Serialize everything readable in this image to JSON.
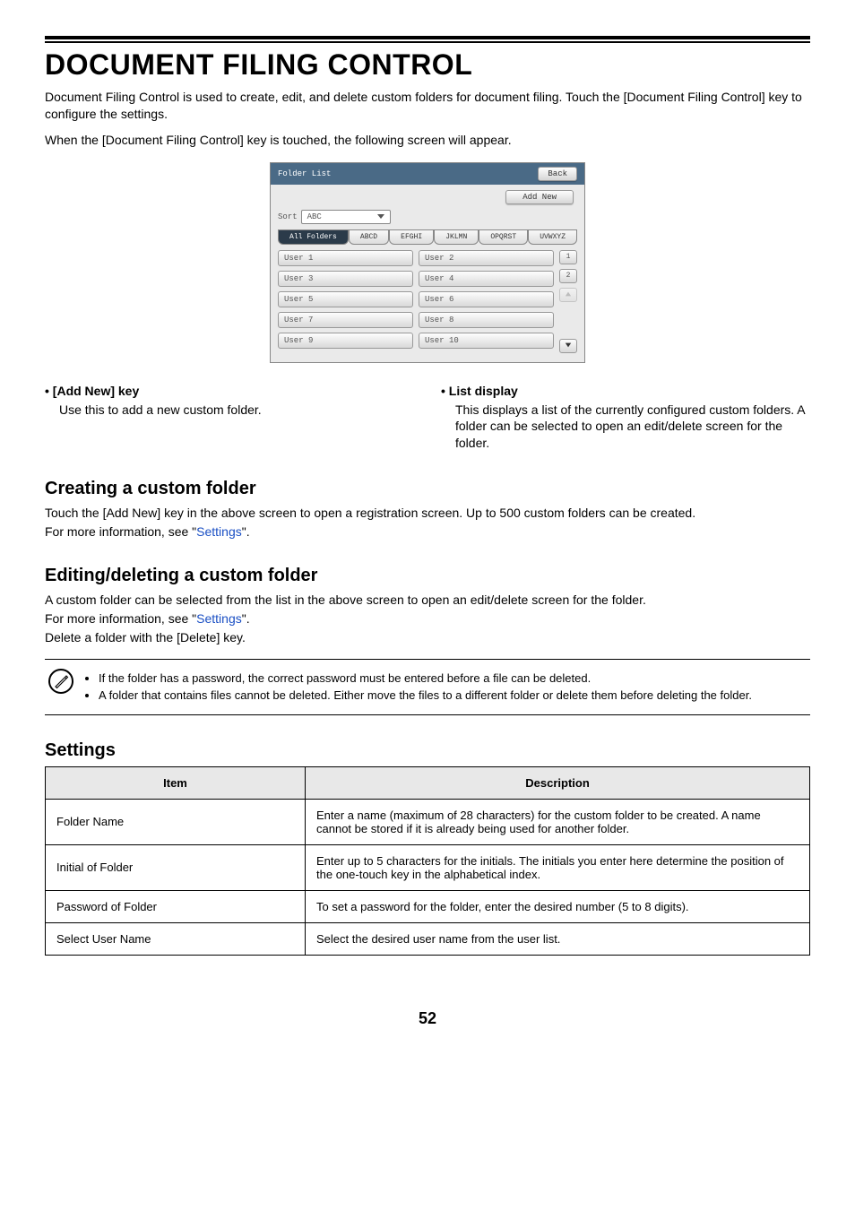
{
  "headings": {
    "main": "DOCUMENT FILING CONTROL",
    "creating": "Creating a custom folder",
    "editing": "Editing/deleting a custom folder",
    "settings": "Settings"
  },
  "intro": {
    "p1": "Document Filing Control is used to create, edit, and delete custom folders for document filing. Touch the [Document Filing Control] key to configure the settings.",
    "p2": "When the [Document Filing Control] key is touched, the following screen will appear."
  },
  "panel": {
    "title": "Folder List",
    "back": "Back",
    "addNew": "Add New",
    "sortLabel": "Sort",
    "sortValue": "ABC",
    "tabs": [
      "All Folders",
      "ABCD",
      "EFGHI",
      "JKLMN",
      "OPQRST",
      "UVWXYZ"
    ],
    "users": [
      "User 1",
      "User 2",
      "User 3",
      "User 4",
      "User 5",
      "User 6",
      "User 7",
      "User 8",
      "User 9",
      "User 10"
    ],
    "page1": "1",
    "page2": "2"
  },
  "bullets": {
    "addNew": {
      "heading": "• [Add New] key",
      "body": "Use this to add a new custom folder."
    },
    "listDisplay": {
      "heading": "• List display",
      "body": "This displays a list of the currently configured custom folders. A folder can be selected to open an edit/delete screen for the folder."
    }
  },
  "creating": {
    "p1a": "Touch the [Add New] key in the above screen to open a registration screen. Up to 500 custom folders can be created.",
    "p2a": "For more information, see \"",
    "link": "Settings",
    "p2b": "\"."
  },
  "editing": {
    "p1": "A custom folder can be selected from the list in the above screen to open an edit/delete screen for the folder.",
    "p2a": "For more information, see \"",
    "link": "Settings",
    "p2b": "\".",
    "p3": "Delete a folder with the [Delete] key."
  },
  "notes": {
    "n1": "If the folder has a password, the correct password must be entered before a file can be deleted.",
    "n2": "A folder that contains files cannot be deleted. Either move the files to a different folder or delete them before deleting the folder."
  },
  "table": {
    "headItem": "Item",
    "headDesc": "Description",
    "rows": [
      {
        "item": "Folder Name",
        "desc": "Enter a name (maximum of 28 characters) for the custom folder to be created. A name cannot be stored if it is already being used for another folder."
      },
      {
        "item": "Initial of Folder",
        "desc": "Enter up to 5 characters for the initials. The initials you enter here determine the position of the one-touch key in the alphabetical index."
      },
      {
        "item": "Password of Folder",
        "desc": "To set a password for the folder, enter the desired number (5 to 8 digits)."
      },
      {
        "item": "Select User Name",
        "desc": "Select the desired user name from the user list."
      }
    ]
  },
  "pageNumber": "52"
}
